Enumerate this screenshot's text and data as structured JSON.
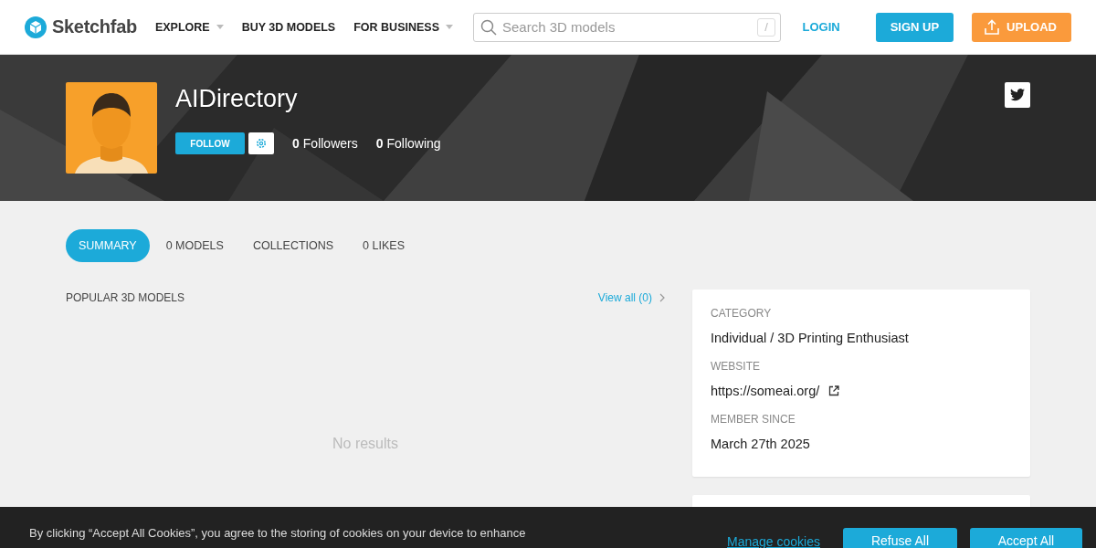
{
  "header": {
    "logo": "Sketchfab",
    "nav": [
      {
        "label": "EXPLORE",
        "dropdown": true
      },
      {
        "label": "BUY 3D MODELS",
        "dropdown": false
      },
      {
        "label": "FOR BUSINESS",
        "dropdown": true
      }
    ],
    "search": {
      "placeholder": "Search 3D models",
      "shortcut": "/"
    },
    "login": "LOGIN",
    "signup": "SIGN UP",
    "upload": "UPLOAD"
  },
  "profile": {
    "name": "AIDirectory",
    "follow": "FOLLOW",
    "followers_count": "0",
    "followers_label": "Followers",
    "following_count": "0",
    "following_label": "Following"
  },
  "tabs": [
    {
      "label": "SUMMARY",
      "selected": true
    },
    {
      "label": "0 MODELS",
      "selected": false
    },
    {
      "label": "COLLECTIONS",
      "selected": false
    },
    {
      "label": "0 LIKES",
      "selected": false
    }
  ],
  "popular": {
    "title": "POPULAR 3D MODELS",
    "view_all": "View all (0)",
    "empty": "No results"
  },
  "info": [
    {
      "label": "CATEGORY",
      "value": "Individual / 3D Printing Enthusiast",
      "kind": "text"
    },
    {
      "label": "WEBSITE",
      "value": "https://someai.org/",
      "kind": "link"
    },
    {
      "label": "MEMBER SINCE",
      "value": "March 27th 2025",
      "kind": "text"
    }
  ],
  "cookie": {
    "text": "By clicking “Accept All Cookies”, you agree to the storing of cookies on your device to enhance",
    "manage": "Manage cookies",
    "refuse": "Refuse All",
    "accept": "Accept All"
  }
}
